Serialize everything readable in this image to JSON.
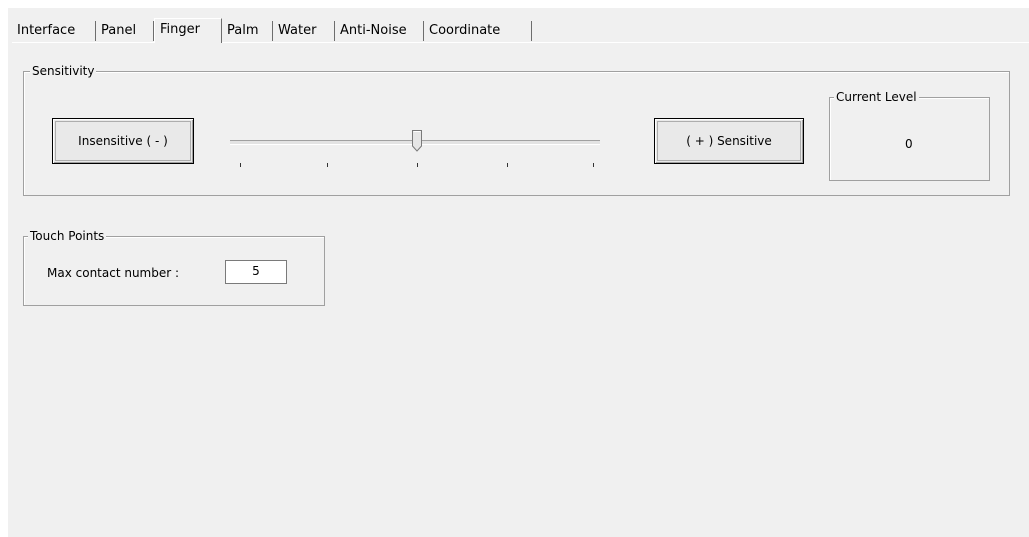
{
  "tabs": [
    {
      "label": "Interface"
    },
    {
      "label": "Panel"
    },
    {
      "label": "Finger",
      "active": true
    },
    {
      "label": "Palm"
    },
    {
      "label": "Water"
    },
    {
      "label": "Anti-Noise"
    },
    {
      "label": "Coordinate"
    }
  ],
  "sensitivity": {
    "title": "Sensitivity",
    "decrease_label": "Insensitive ( - )",
    "increase_label": "( + ) Sensitive",
    "slider_position_fraction": 0.5,
    "tick_count": 5
  },
  "current_level": {
    "title": "Current Level",
    "value": "0"
  },
  "touch_points": {
    "title": "Touch Points",
    "max_contact_label": "Max contact number :",
    "max_contact_value": "5"
  }
}
